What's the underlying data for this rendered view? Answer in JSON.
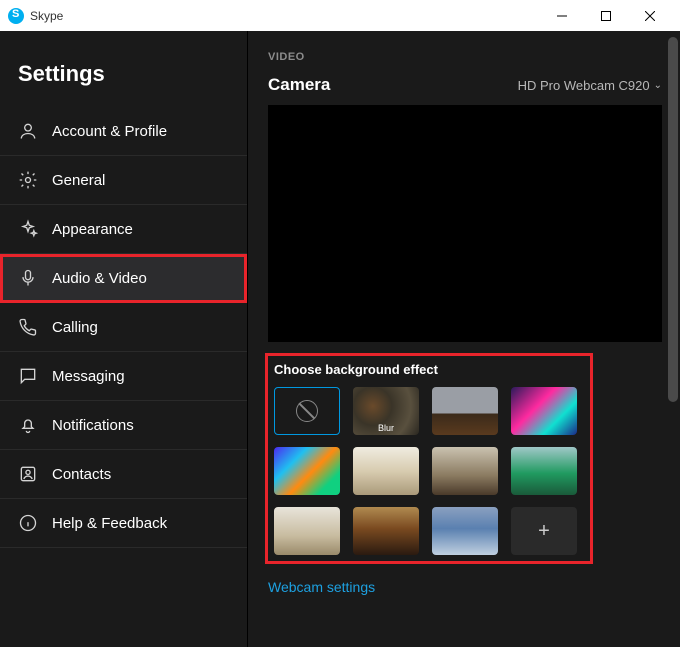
{
  "titlebar": {
    "app_name": "Skype"
  },
  "sidebar": {
    "title": "Settings",
    "items": [
      {
        "label": "Account & Profile"
      },
      {
        "label": "General"
      },
      {
        "label": "Appearance"
      },
      {
        "label": "Audio & Video"
      },
      {
        "label": "Calling"
      },
      {
        "label": "Messaging"
      },
      {
        "label": "Notifications"
      },
      {
        "label": "Contacts"
      },
      {
        "label": "Help & Feedback"
      }
    ]
  },
  "main": {
    "section_label": "VIDEO",
    "camera_label": "Camera",
    "camera_value": "HD Pro Webcam C920",
    "bg_title": "Choose background effect",
    "blur_label": "Blur",
    "webcam_settings": "Webcam settings"
  }
}
